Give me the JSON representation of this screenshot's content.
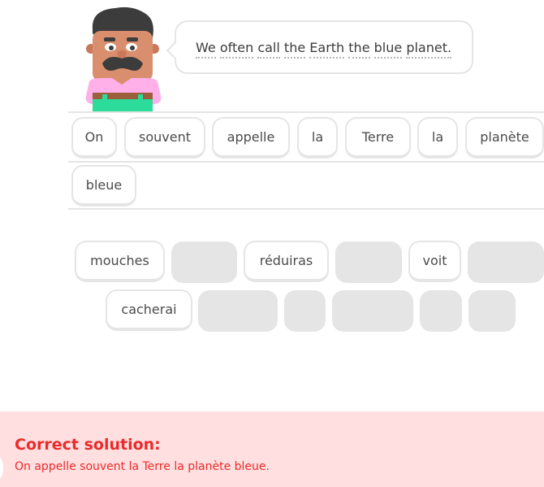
{
  "prompt": {
    "words": [
      "We",
      "often",
      "call",
      "the",
      "Earth",
      "the",
      "blue",
      "planet."
    ]
  },
  "answer_tiles": [
    "On",
    "souvent",
    "appelle",
    "la",
    "Terre",
    "la",
    "planète",
    "bleue"
  ],
  "word_bank": {
    "tiles": [
      "mouches",
      "réduiras",
      "voit",
      "cacherai"
    ]
  },
  "feedback": {
    "title": "Correct solution:",
    "solution": "On appelle souvent la Terre la planète bleue."
  },
  "colors": {
    "error_red": "#ea2b2b",
    "feedback_bg": "#ffdfe0",
    "tile_border": "#e5e5e5",
    "slot_gray": "#e5e5e5"
  }
}
